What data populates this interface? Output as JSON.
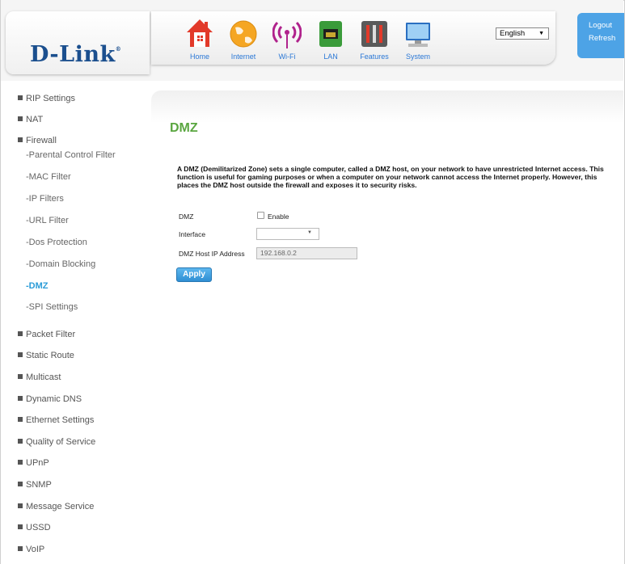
{
  "brand": {
    "logo_text": "D-Link",
    "logo_mark": "®"
  },
  "topnav": {
    "items": [
      {
        "label": "Home",
        "icon": "home-icon"
      },
      {
        "label": "Internet",
        "icon": "globe-icon"
      },
      {
        "label": "Wi-Fi",
        "icon": "wifi-icon"
      },
      {
        "label": "LAN",
        "icon": "lan-port-icon"
      },
      {
        "label": "Features",
        "icon": "tools-icon"
      },
      {
        "label": "System",
        "icon": "computer-icon"
      }
    ]
  },
  "language": {
    "selected": "English"
  },
  "account": {
    "logout": "Logout",
    "refresh": "Refresh"
  },
  "sidebar": {
    "groups": [
      {
        "label": "RIP Settings"
      },
      {
        "label": "NAT"
      },
      {
        "label": "Firewall"
      },
      {
        "label": "Packet Filter"
      },
      {
        "label": "Static Route"
      },
      {
        "label": "Multicast"
      },
      {
        "label": "Dynamic DNS"
      },
      {
        "label": "Ethernet Settings"
      },
      {
        "label": "Quality of Service"
      },
      {
        "label": "UPnP"
      },
      {
        "label": "SNMP"
      },
      {
        "label": "Message Service"
      },
      {
        "label": "USSD"
      },
      {
        "label": "VoIP"
      }
    ],
    "firewall_subitems": [
      {
        "label": "-Parental Control Filter"
      },
      {
        "label": "-MAC Filter"
      },
      {
        "label": "-IP Filters"
      },
      {
        "label": "-URL Filter"
      },
      {
        "label": "-Dos Protection"
      },
      {
        "label": "-Domain Blocking"
      },
      {
        "label": "-DMZ",
        "active": true
      },
      {
        "label": "-SPI Settings"
      }
    ]
  },
  "main": {
    "title": "DMZ",
    "description": "A DMZ (Demilitarized Zone) sets a single computer, called a DMZ host, on your network to have unrestricted Internet access. This function is useful for gaming purposes or when a computer on your network cannot access the Internet properly. However, this places the DMZ host outside the firewall and exposes it to security risks.",
    "dmz_label": "DMZ",
    "enable_label": "Enable",
    "enable_checked": false,
    "interface_label": "Interface",
    "interface_value": "",
    "host_ip_label": "DMZ Host IP Address",
    "host_ip_placeholder": "192.168.0.2",
    "apply_label": "Apply"
  },
  "colors": {
    "accent_blue": "#2b9cd8",
    "title_green": "#5aa640",
    "logo_blue": "#1b4f8e",
    "account_blue": "#4da3e6"
  }
}
